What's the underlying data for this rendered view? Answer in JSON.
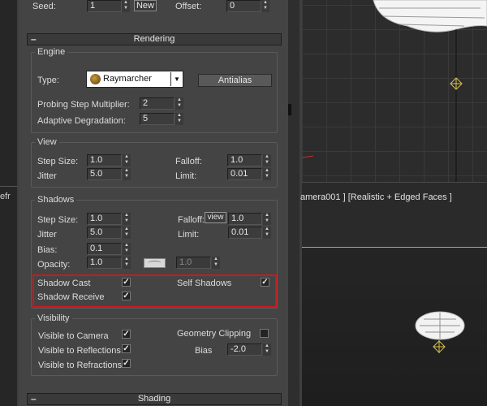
{
  "top": {
    "seed_label": "Seed:",
    "seed_value": "1",
    "new_button": "New",
    "offset_label": "Offset:",
    "offset_value": "0"
  },
  "rendering": {
    "rollout_title": "Rendering",
    "engine": {
      "group_title": "Engine",
      "type_label": "Type:",
      "type_value": "Raymarcher",
      "antialias_button": "Antialias",
      "probing_label": "Probing Step Multiplier:",
      "probing_value": "2",
      "adaptive_label": "Adaptive Degradation:",
      "adaptive_value": "5"
    },
    "view": {
      "group_title": "View",
      "step_size_label": "Step Size:",
      "step_size_value": "1.0",
      "jitter_label": "Jitter",
      "jitter_value": "5.0",
      "falloff_label": "Falloff:",
      "falloff_value": "1.0",
      "limit_label": "Limit:",
      "limit_value": "0.01"
    },
    "shadows": {
      "group_title": "Shadows",
      "step_size_label": "Step Size:",
      "step_size_value": "1.0",
      "jitter_label": "Jitter",
      "jitter_value": "5.0",
      "falloff_label": "Falloff:",
      "view_button": "view",
      "falloff_value": "1.0",
      "limit_label": "Limit:",
      "limit_value": "0.01",
      "bias_label": "Bias:",
      "bias_value": "0.1",
      "opacity_label": "Opacity:",
      "opacity_value": "1.0",
      "opacity_map_value": "1.0",
      "shadow_cast_label": "Shadow Cast",
      "shadow_cast_checked": true,
      "shadow_receive_label": "Shadow Receive",
      "shadow_receive_checked": true,
      "self_shadows_label": "Self Shadows",
      "self_shadows_checked": true
    },
    "visibility": {
      "group_title": "Visibility",
      "visible_camera_label": "Visible to Camera",
      "visible_camera_checked": true,
      "visible_reflections_label": "Visible to Reflections",
      "visible_reflections_checked": true,
      "visible_refractions_label": "Visible to Refractions",
      "visible_refractions_checked": true,
      "geometry_clipping_label": "Geometry Clipping",
      "geometry_clipping_checked": false,
      "bias_label": "Bias",
      "bias_value": "-2.0"
    }
  },
  "shading": {
    "rollout_title": "Shading"
  },
  "left_strip": {
    "label": "efr"
  },
  "viewport": {
    "bottom_label": "amera001 ] [Realistic + Edged Faces ]"
  },
  "colors": {
    "highlight_border": "#d0161b",
    "viewport_grid": "#3c3c3c",
    "viewport_divider": "#c8b400"
  }
}
